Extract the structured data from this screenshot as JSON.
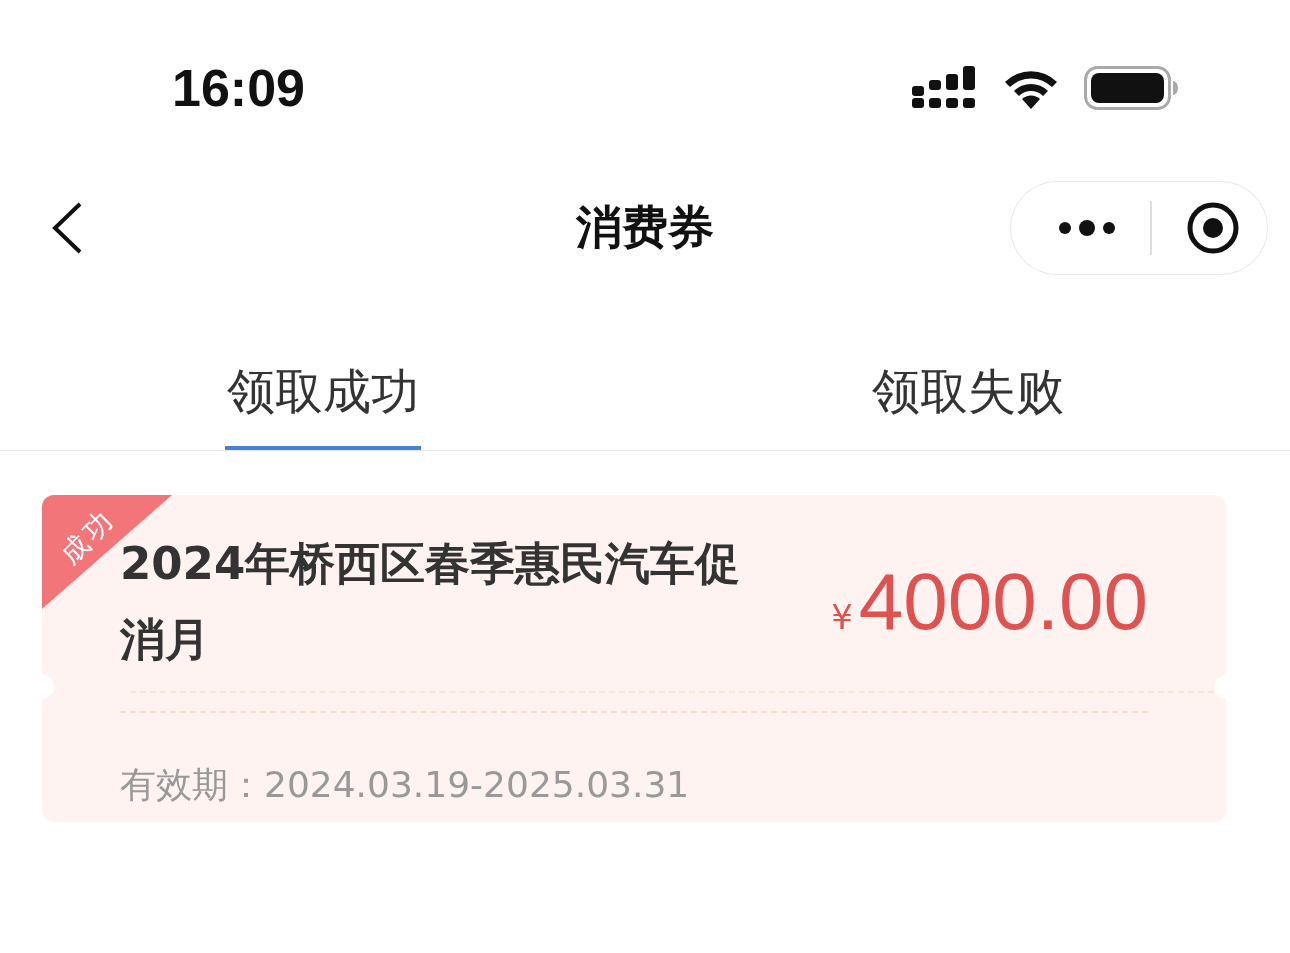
{
  "status_bar": {
    "time": "16:09"
  },
  "nav": {
    "title": "消费券"
  },
  "tabs": [
    {
      "label": "领取成功",
      "selected": true
    },
    {
      "label": "领取失败",
      "selected": false
    }
  ],
  "coupons": [
    {
      "badge": "成功",
      "title": "2024年桥西区春季惠民汽车促消月",
      "currency": "¥",
      "amount": "4000.00",
      "validity_label": "有效期：",
      "validity": "2024.03.19-2025.03.31"
    }
  ]
}
